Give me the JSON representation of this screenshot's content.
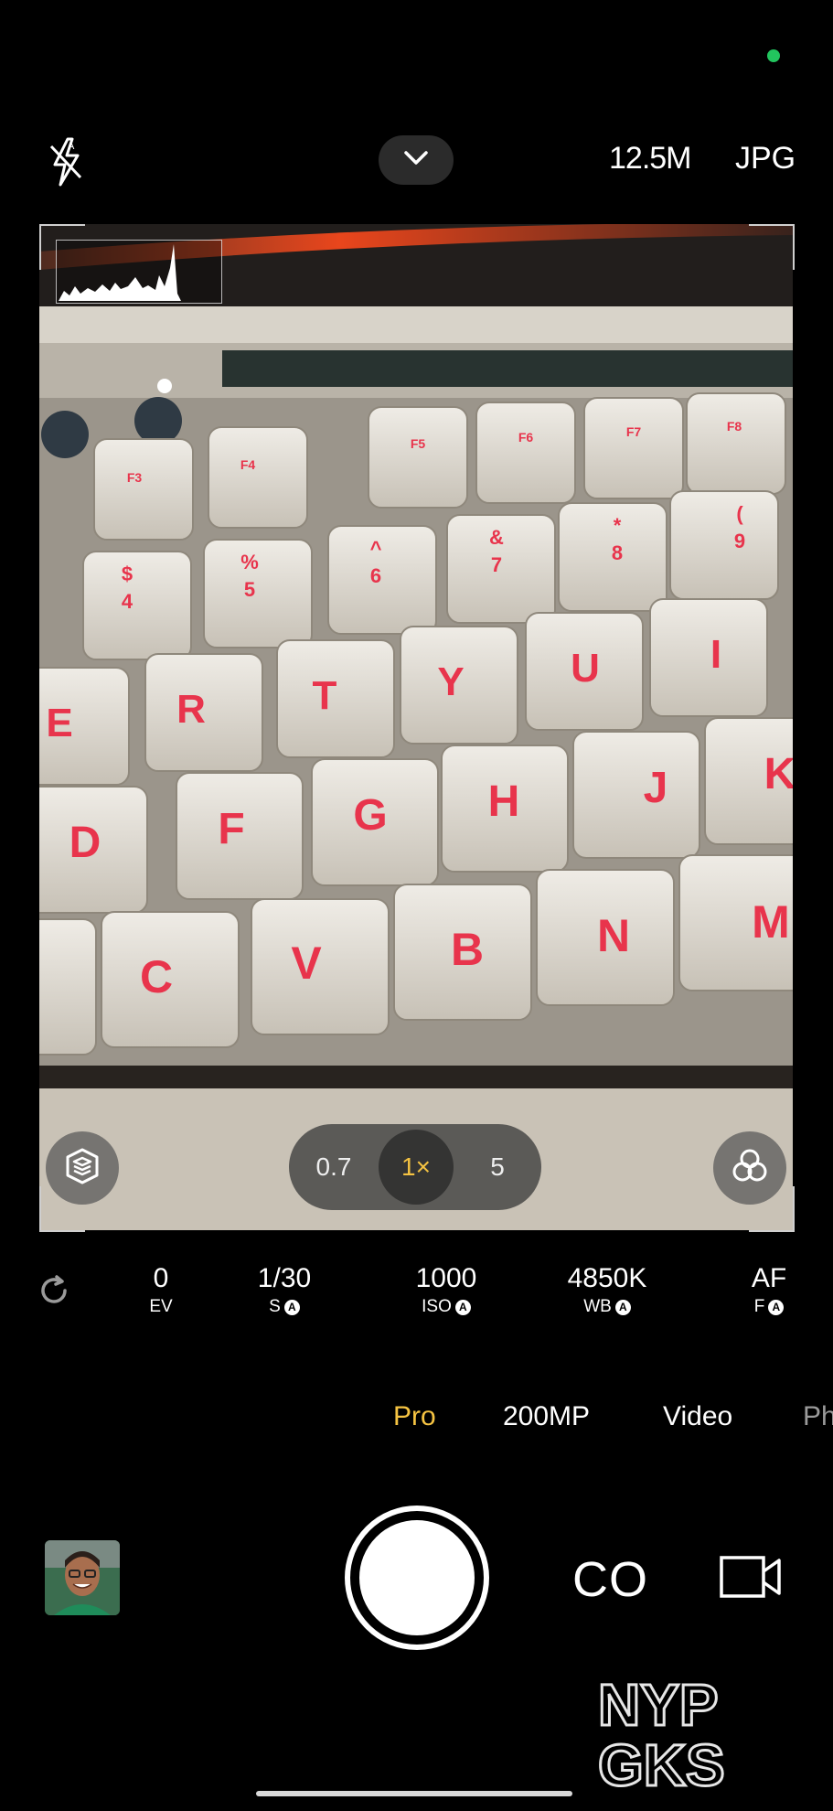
{
  "top_bar": {
    "flash_icon": "flash-auto-off-icon",
    "chevron_icon": "chevron-down-icon",
    "resolution": "12.5M",
    "format": "JPG"
  },
  "viewfinder": {
    "histogram_icon": "histogram",
    "zoom": {
      "options": [
        "0.7",
        "1×",
        "5"
      ],
      "selected": "1×"
    },
    "layers_icon": "layers-icon",
    "filter_icon": "filter-circles-icon"
  },
  "pro_controls": {
    "reset_icon": "refresh-icon",
    "params": [
      {
        "value": "0",
        "label": "EV",
        "auto": false
      },
      {
        "value": "1/30",
        "label": "S",
        "auto": true
      },
      {
        "value": "1000",
        "label": "ISO",
        "auto": true
      },
      {
        "value": "4850K",
        "label": "WB",
        "auto": true
      },
      {
        "value": "AF",
        "label": "F",
        "auto": true
      }
    ],
    "auto_badge": "A"
  },
  "modes": {
    "items": [
      "Pro",
      "200MP",
      "Video",
      "Ph"
    ],
    "active": "Pro"
  },
  "bottom": {
    "capture_mode_label": "CO",
    "video_icon": "video-camera-icon",
    "thumbnail": "last-photo-thumbnail"
  },
  "colors": {
    "accent": "#f5c342",
    "zoom_selected": "#f5c342",
    "privacy_dot": "#22c55e"
  },
  "watermark": {
    "line1": "NYP",
    "line2": "GKS"
  }
}
